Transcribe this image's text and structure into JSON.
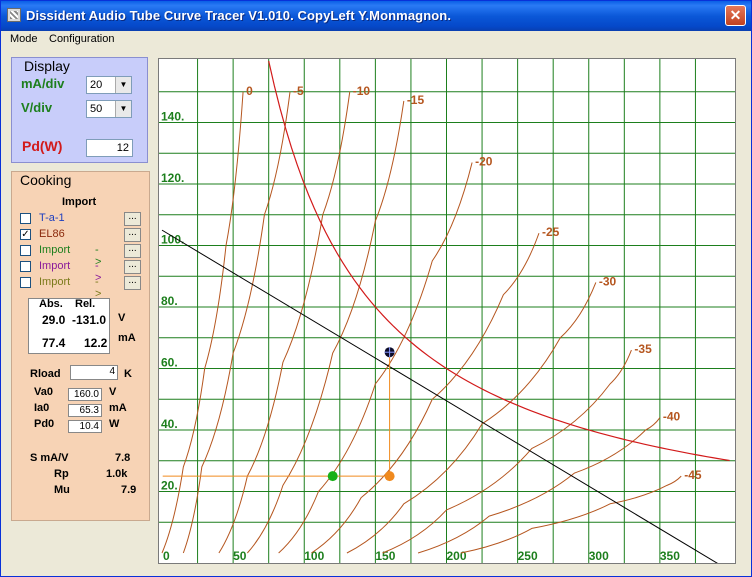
{
  "window": {
    "title": "Dissident Audio Tube Curve Tracer V1.010. CopyLeft Y.Monmagnon.",
    "close_glyph": "✕"
  },
  "menu": [
    {
      "label": "Mode"
    },
    {
      "label": "Configuration"
    }
  ],
  "display": {
    "title": "Display",
    "ma_div_label": "mA/div",
    "ma_div_value": "20",
    "v_div_label": "V/div",
    "v_div_value": "50",
    "pd_label": "Pd(W)",
    "pd_value": "12",
    "combo_arrow": "▼"
  },
  "cooking": {
    "title": "Cooking",
    "import_title": "Import",
    "dots_label": "...",
    "tubes": [
      {
        "name": "T-a-1",
        "arrow": "",
        "checked": false,
        "color": "#1e3fc0"
      },
      {
        "name": "EL86",
        "arrow": "",
        "checked": true,
        "color": "#8b2a0c"
      },
      {
        "name": "Import",
        "arrow": "->",
        "checked": false,
        "color": "#1d7f1d"
      },
      {
        "name": "Import",
        "arrow": "->",
        "checked": false,
        "color": "#8a1a9a"
      },
      {
        "name": "Import",
        "arrow": "->",
        "checked": false,
        "color": "#7a7a1a"
      }
    ],
    "check_mark": "✓",
    "readout": {
      "abs_header": "Abs.",
      "rel_header": "Rel.",
      "abs_v": "29.0",
      "rel_v": "-131.0",
      "unit_v": "V",
      "abs_ma": "77.4",
      "rel_ma": "12.2",
      "unit_ma": "mA"
    },
    "rload": {
      "label": "Rload",
      "value": "4",
      "unit": "K"
    },
    "va0": {
      "label": "Va0",
      "value": "160.0",
      "unit": "V"
    },
    "ia0": {
      "label": "Ia0",
      "value": "65.3",
      "unit": "mA"
    },
    "pd0": {
      "label": "Pd0",
      "value": "10.4",
      "unit": "W"
    },
    "s": {
      "label": "S mA/V",
      "value": "7.8"
    },
    "rp": {
      "label": "Rp",
      "value": "1.0k"
    },
    "mu": {
      "label": "Mu",
      "value": "7.9"
    }
  },
  "chart_data": {
    "type": "line",
    "title": "",
    "xlabel": "",
    "ylabel": "",
    "xlim": [
      0,
      400
    ],
    "ylim": [
      0,
      160
    ],
    "x_ticks": [
      "0",
      "50",
      "100",
      "150",
      "200",
      "250",
      "300",
      "350"
    ],
    "y_ticks": [
      "20.",
      "40.",
      "60.",
      "80.",
      "100.",
      "120.",
      "140."
    ],
    "grid": true,
    "grid_color": "#1d7f1d",
    "curve_color": "#b5561f",
    "series": [
      {
        "name": "0",
        "values": [
          [
            0,
            0
          ],
          [
            15,
            28
          ],
          [
            30,
            60
          ],
          [
            45,
            100
          ],
          [
            57,
            150
          ]
        ]
      },
      {
        "name": "-5",
        "values": [
          [
            15,
            0
          ],
          [
            28,
            28
          ],
          [
            50,
            65
          ],
          [
            72,
            110
          ],
          [
            90,
            150
          ]
        ]
      },
      {
        "name": "-10",
        "values": [
          [
            40,
            0
          ],
          [
            60,
            25
          ],
          [
            85,
            62
          ],
          [
            113,
            110
          ],
          [
            132,
            150
          ]
        ]
      },
      {
        "name": "-15",
        "values": [
          [
            60,
            0
          ],
          [
            85,
            22
          ],
          [
            120,
            65
          ],
          [
            150,
            108
          ],
          [
            170,
            147
          ]
        ]
      },
      {
        "name": "-20",
        "values": [
          [
            82,
            0
          ],
          [
            110,
            20
          ],
          [
            150,
            55
          ],
          [
            190,
            95
          ],
          [
            218,
            127
          ]
        ]
      },
      {
        "name": "-25",
        "values": [
          [
            105,
            0
          ],
          [
            140,
            18
          ],
          [
            190,
            50
          ],
          [
            240,
            84
          ],
          [
            265,
            104
          ]
        ]
      },
      {
        "name": "-30",
        "values": [
          [
            130,
            0
          ],
          [
            170,
            16
          ],
          [
            225,
            42
          ],
          [
            280,
            70
          ],
          [
            305,
            88
          ]
        ]
      },
      {
        "name": "-35",
        "values": [
          [
            155,
            0
          ],
          [
            200,
            14
          ],
          [
            260,
            34
          ],
          [
            315,
            55
          ],
          [
            330,
            66
          ]
        ]
      },
      {
        "name": "-40",
        "values": [
          [
            180,
            0
          ],
          [
            230,
            12
          ],
          [
            290,
            26
          ],
          [
            340,
            40
          ],
          [
            350,
            44
          ]
        ]
      },
      {
        "name": "-45",
        "values": [
          [
            210,
            0
          ],
          [
            260,
            8
          ],
          [
            315,
            16
          ],
          [
            355,
            22
          ],
          [
            365,
            25
          ]
        ]
      }
    ],
    "load_line": {
      "color": "#000000",
      "points": [
        [
          0,
          105
        ],
        [
          400,
          -6
        ]
      ]
    },
    "power_hyperbola": {
      "color": "#d21a1a",
      "watts": 12
    },
    "operating_point": {
      "x": 160,
      "y": 65.3,
      "color": "#0c0c2a"
    },
    "cursor_point": {
      "x": 160,
      "y": 25,
      "color": "#f08a1e"
    },
    "cursor_origin": {
      "x": 120,
      "y": 25,
      "color": "#19b119"
    }
  }
}
